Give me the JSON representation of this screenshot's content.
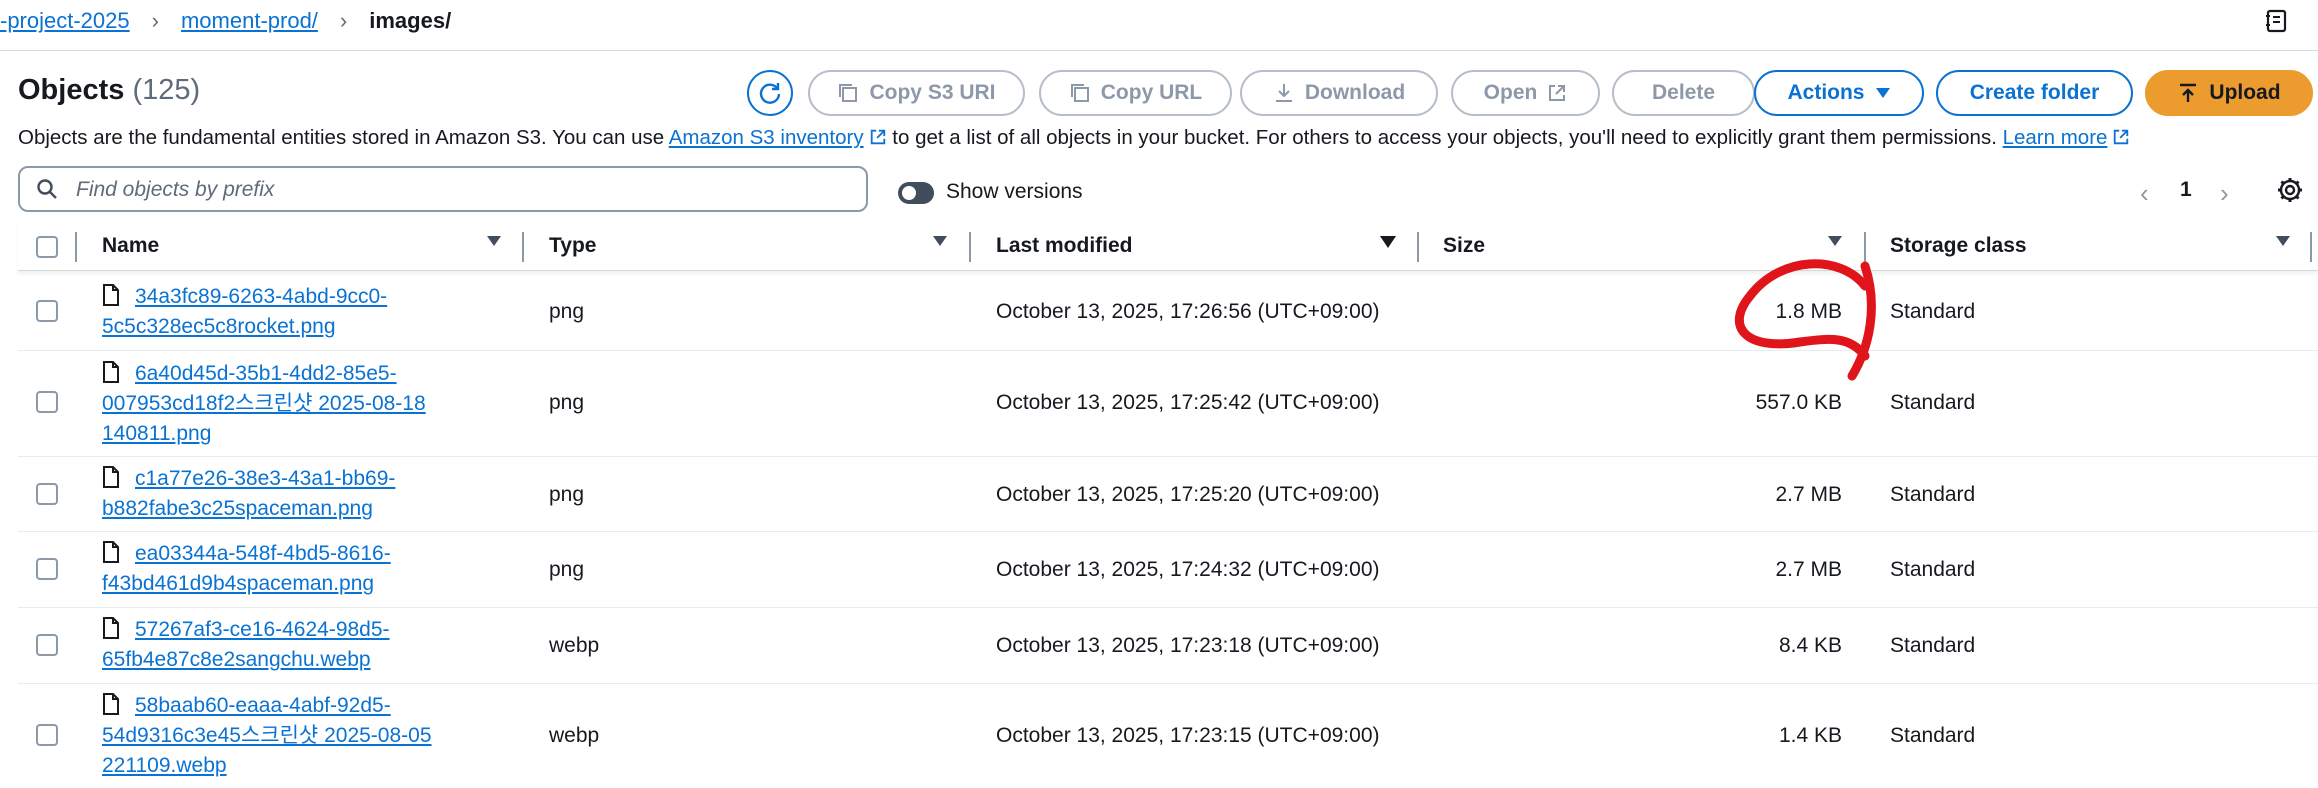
{
  "breadcrumb": {
    "items": [
      "-project-2025",
      "moment-prod/"
    ],
    "current": "images/"
  },
  "header": {
    "title": "Objects",
    "count": "(125)",
    "buttons": {
      "copy_s3_uri": "Copy S3 URI",
      "copy_url": "Copy URL",
      "download": "Download",
      "open": "Open",
      "delete": "Delete",
      "actions": "Actions",
      "create_folder": "Create folder",
      "upload": "Upload"
    }
  },
  "description": {
    "before": "Objects are the fundamental entities stored in Amazon S3. You can use ",
    "link1": "Amazon S3 inventory",
    "middle": " to get a list of all objects in your bucket. For others to access your objects, you'll need to explicitly grant them permissions. ",
    "link2": "Learn more"
  },
  "search": {
    "placeholder": "Find objects by prefix",
    "value": ""
  },
  "versions_toggle": {
    "label": "Show versions",
    "on": false
  },
  "pagination": {
    "page": "1"
  },
  "table": {
    "columns": [
      "Name",
      "Type",
      "Last modified",
      "Size",
      "Storage class"
    ],
    "rows": [
      {
        "name": "34a3fc89-6263-4abd-9cc0-\n5c5c328ec5c8rocket.png",
        "type": "png",
        "modified": "October 13, 2025, 17:26:56 (UTC+09:00)",
        "size": "1.8 MB",
        "storage": "Standard"
      },
      {
        "name": "6a40d45d-35b1-4dd2-85e5-\n007953cd18f2스크린샷 2025-08-18\n140811.png",
        "type": "png",
        "modified": "October 13, 2025, 17:25:42 (UTC+09:00)",
        "size": "557.0 KB",
        "storage": "Standard"
      },
      {
        "name": "c1a77e26-38e3-43a1-bb69-\nb882fabe3c25spaceman.png",
        "type": "png",
        "modified": "October 13, 2025, 17:25:20 (UTC+09:00)",
        "size": "2.7 MB",
        "storage": "Standard"
      },
      {
        "name": "ea03344a-548f-4bd5-8616-\nf43bd461d9b4spaceman.png",
        "type": "png",
        "modified": "October 13, 2025, 17:24:32 (UTC+09:00)",
        "size": "2.7 MB",
        "storage": "Standard"
      },
      {
        "name": "57267af3-ce16-4624-98d5-\n65fb4e87c8e2sangchu.webp",
        "type": "webp",
        "modified": "October 13, 2025, 17:23:18 (UTC+09:00)",
        "size": "8.4 KB",
        "storage": "Standard"
      },
      {
        "name": "58baab60-eaaa-4abf-92d5-\n54d9316c3e45스크린샷 2025-08-05\n221109.webp",
        "type": "webp",
        "modified": "October 13, 2025, 17:23:15 (UTC+09:00)",
        "size": "1.4 KB",
        "storage": "Standard"
      }
    ]
  },
  "colors": {
    "link": "#0972d3",
    "upload": "#ec9b2f",
    "annotation": "#e0151b"
  }
}
